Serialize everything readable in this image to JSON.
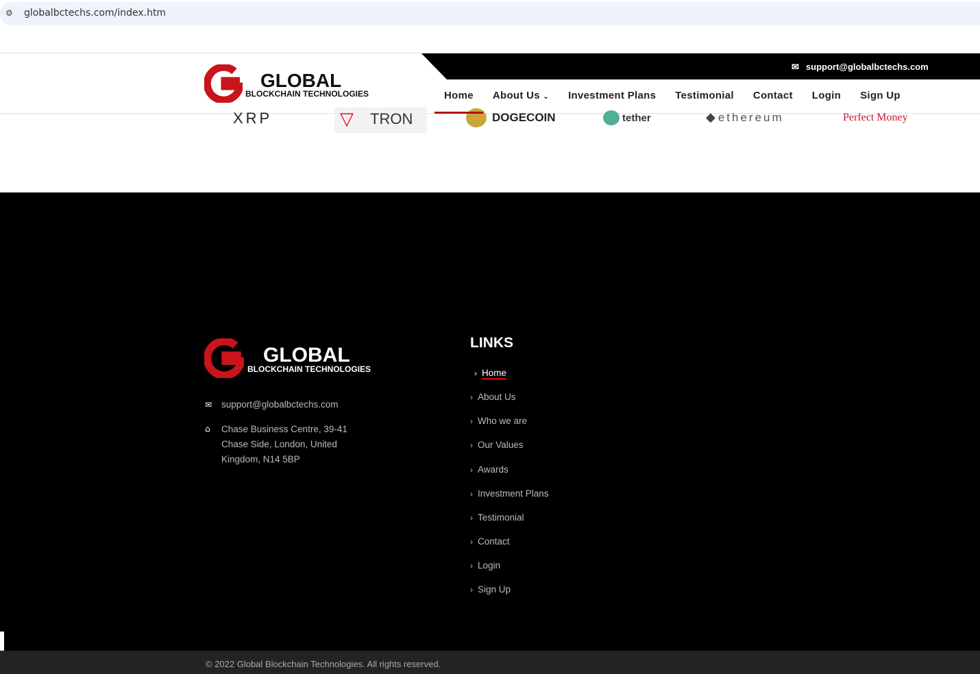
{
  "browser": {
    "url": "globalbctechs.com/index.htm"
  },
  "header": {
    "email": "support@globalbctechs.com",
    "logo": {
      "title": "GLOBAL",
      "subtitle": "BLOCKCHAIN TECHNOLOGIES"
    },
    "nav": [
      {
        "label": "Home"
      },
      {
        "label": "About Us"
      },
      {
        "label": "Investment Plans"
      },
      {
        "label": "Testimonial"
      },
      {
        "label": "Contact"
      },
      {
        "label": "Login"
      },
      {
        "label": "Sign Up"
      }
    ],
    "about_chevron": "›"
  },
  "partners": [
    "XRP",
    "TRON",
    "DOGECOIN",
    "tether",
    "ethereum",
    "Perfect Money"
  ],
  "footer": {
    "logo": {
      "title": "GLOBAL",
      "subtitle": "BLOCKCHAIN TECHNOLOGIES"
    },
    "email": "support@globalbctechs.com",
    "address": [
      "Chase Business Centre, 39-41",
      "Chase Side, London, United",
      "Kingdom, N14 5BP"
    ],
    "links_heading": "LINKS",
    "links": [
      "Home",
      "About Us",
      "Who we are",
      "Our Values",
      "Awards",
      "Investment Plans",
      "Testimonial",
      "Contact",
      "Login",
      "Sign Up"
    ],
    "copyright": "© 2022 Global Blockchain Technologies. All rights reserved."
  },
  "colors": {
    "brand_red": "#c8141a",
    "accent": "#b01010"
  }
}
